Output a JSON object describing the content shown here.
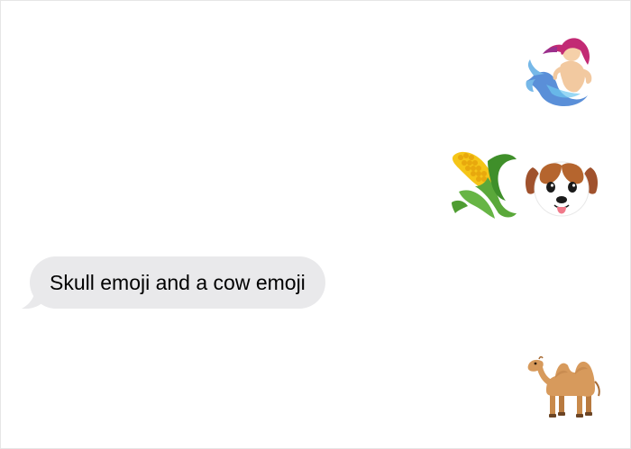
{
  "conversation": {
    "messages": [
      {
        "type": "emoji",
        "icon": "mermaid-icon"
      },
      {
        "type": "emoji",
        "icons": [
          "corn-icon",
          "dog-face-icon"
        ]
      },
      {
        "type": "text",
        "text": "Skull emoji and a cow emoji",
        "bubble_color": "#e9e9eb"
      },
      {
        "type": "emoji",
        "icon": "camel-icon"
      }
    ]
  }
}
